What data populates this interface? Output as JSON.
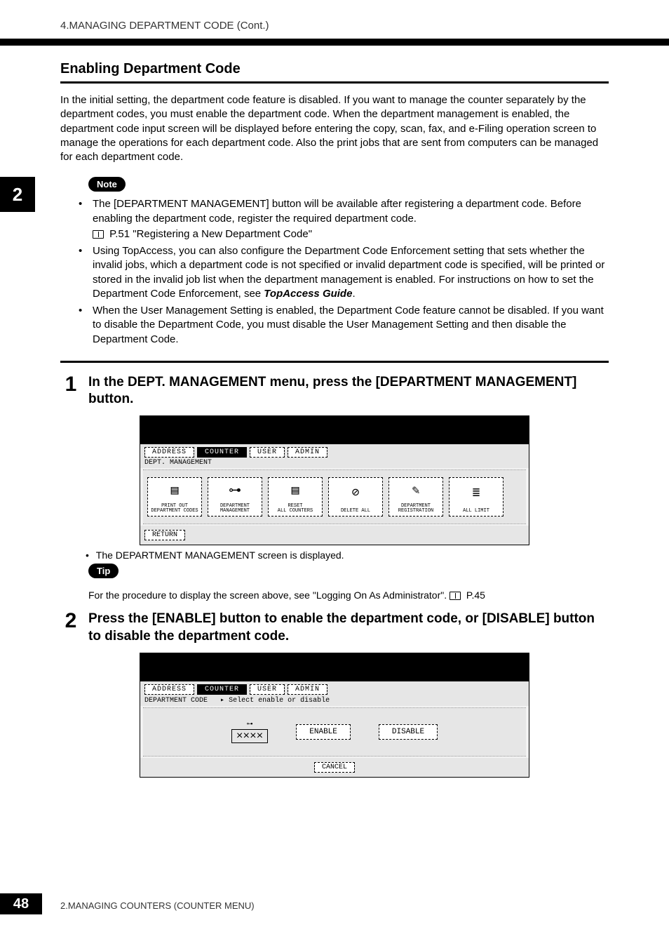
{
  "breadcrumb": "4.MANAGING DEPARTMENT CODE (Cont.)",
  "side_tab": "2",
  "page_number": "48",
  "footer": "2.MANAGING COUNTERS (COUNTER MENU)",
  "section_title": "Enabling Department Code",
  "intro_para": "In the initial setting, the department code feature is disabled.  If you want to manage the counter separately by the department codes, you must enable the department code.  When the department management is enabled, the department code input screen will be displayed before entering the copy, scan, fax, and e-Filing operation screen to manage the operations for each department code.  Also the print jobs that are sent from computers can be managed for each department code.",
  "note_label": "Note",
  "notes": {
    "n1a": "The [DEPARTMENT MANAGEMENT] button will be available after registering a department code. Before enabling the department code, register the required department code.",
    "n1_xref": "P.51 \"Registering a New Department Code\"",
    "n2a": "Using TopAccess, you can also configure the Department Code Enforcement setting that sets whether the invalid jobs, which a department code is not specified or invalid department code is specified, will be printed or stored in the invalid job list when the department management is enabled. For instructions on how to set the Department Code Enforcement, see ",
    "n2b": "TopAccess Guide",
    "n2c": ".",
    "n3": "When the User Management Setting is enabled, the Department Code feature cannot be disabled. If you want to disable the Department Code, you must disable the User Management Setting and then disable the Department Code."
  },
  "step1": {
    "num": "1",
    "text": "In the DEPT. MANAGEMENT menu, press the [DEPARTMENT MANAGEMENT] button.",
    "after": "The DEPARTMENT MANAGEMENT screen is displayed."
  },
  "tip_label": "Tip",
  "tip_text_a": "For the procedure to display the screen above, see \"Logging On As Administrator\".  ",
  "tip_text_b": "P.45",
  "step2": {
    "num": "2",
    "text": "Press the [ENABLE] button to enable the department code, or [DISABLE] button to disable the department code."
  },
  "ss_tabs": {
    "address": "ADDRESS",
    "counter": "COUNTER",
    "user": "USER",
    "admin": "ADMIN"
  },
  "ss1": {
    "subtitle": "DEPT. MANAGEMENT",
    "buttons": {
      "b1": "PRINT OUT\nDEPARTMENT CODES",
      "b2": "DEPARTMENT\nMANAGEMENT",
      "b3": "RESET\nALL COUNTERS",
      "b4": "DELETE ALL",
      "b5": "DEPARTMENT\nREGISTRATION",
      "b6": "ALL LIMIT"
    },
    "return": "RETURN"
  },
  "ss2": {
    "subtitle": "DEPARTMENT CODE",
    "subarrow": "Select enable or disable",
    "xxxx": "××××",
    "enable": "ENABLE",
    "disable": "DISABLE",
    "cancel": "CANCEL"
  }
}
